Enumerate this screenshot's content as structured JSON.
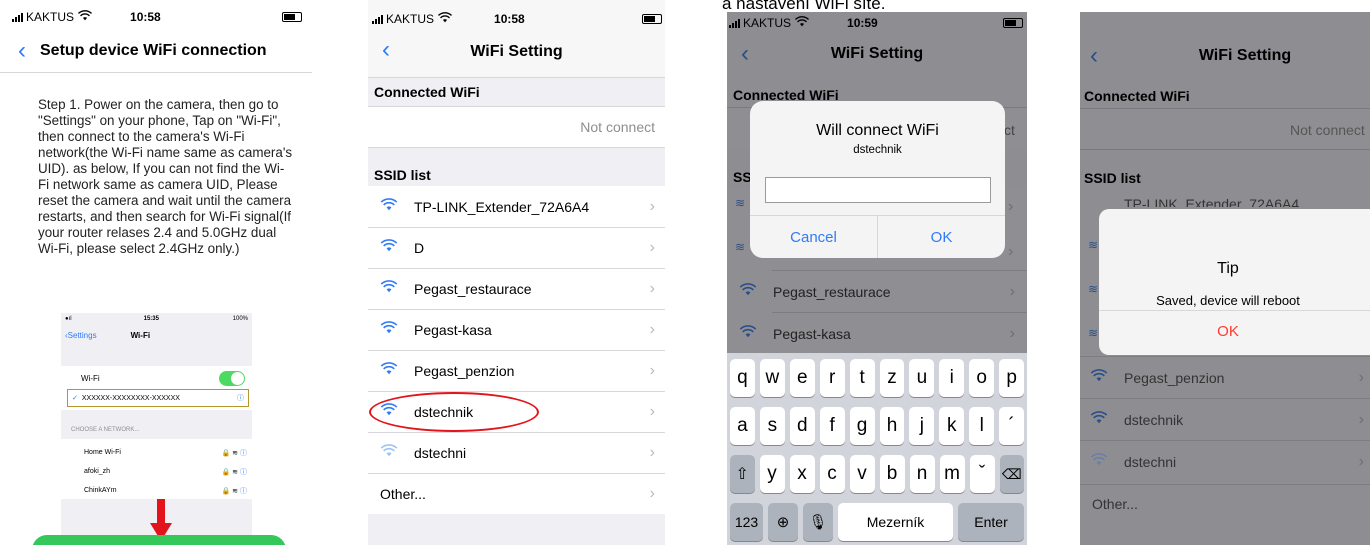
{
  "screen1": {
    "carrier": "KAKTUS",
    "time": "10:58",
    "title": "Setup device WiFi connection",
    "step_text": "Step 1. Power on the camera, then go to \"Settings\" on your phone, Tap on \"Wi-Fi\", then connect to the camera's Wi-Fi network(the Wi-Fi name same as camera's UID). as below, If you can not find the Wi-Fi network same as camera UID, Please reset the camera and wait until the camera restarts, and then search for Wi-Fi signal(If your router relases 2.4 and 5.0GHz dual Wi-Fi, please select 2.4GHz only.)",
    "mini": {
      "time": "15:35",
      "battery": "100%",
      "back_label": "Settings",
      "title": "Wi-Fi",
      "wifi_label": "Wi-Fi",
      "connected_ssid": "XXXXXX-XXXXXXXX-XXXXXX",
      "choose_label": "CHOOSE A NETWORK...",
      "networks": [
        "Home Wi-Fi",
        "afoki_zh",
        "ChinkAYm"
      ]
    }
  },
  "screen2": {
    "carrier": "KAKTUS",
    "time": "10:58",
    "title": "WiFi Setting",
    "connected_header": "Connected WiFi",
    "connected_value": "Not connect",
    "ssid_header": "SSID list",
    "ssids": [
      "TP-LINK_Extender_72A6A4",
      "D",
      "Pegast_restaurace",
      "Pegast-kasa",
      "Pegast_penzion",
      "dstechnik",
      "dstechni"
    ],
    "other": "Other..."
  },
  "screen3": {
    "caption": "a nastavení WiFi sítě.",
    "carrier": "KAKTUS",
    "time": "10:59",
    "title": "WiFi Setting",
    "connected_header": "Connected WiFi",
    "connected_value_partial": "ct",
    "ssid_partial": "SS",
    "dialog": {
      "title": "Will connect WiFi",
      "subtitle": "dstechnik",
      "input_value": "",
      "cancel": "Cancel",
      "ok": "OK"
    },
    "ssids_visible": [
      "Pegast_restaurace",
      "Pegast-kasa"
    ],
    "keyboard": {
      "row1": [
        "q",
        "w",
        "e",
        "r",
        "t",
        "z",
        "u",
        "i",
        "o",
        "p"
      ],
      "row2": [
        "a",
        "s",
        "d",
        "f",
        "g",
        "h",
        "j",
        "k",
        "l",
        "´"
      ],
      "row3": [
        "y",
        "x",
        "c",
        "v",
        "b",
        "n",
        "m",
        "ˇ"
      ],
      "numbers_key": "123",
      "space_key": "Mezerník",
      "enter_key": "Enter"
    }
  },
  "screen4": {
    "title": "WiFi Setting",
    "connected_header": "Connected WiFi",
    "connected_value": "Not connect",
    "ssid_header": "SSID list",
    "ssid_partial": "TP-LINK_Extender_72A6A4",
    "ssids_visible": [
      "Pegast_penzion",
      "dstechnik",
      "dstechni"
    ],
    "other": "Other...",
    "tip": {
      "title": "Tip",
      "message": "Saved, device will reboot",
      "ok": "OK"
    }
  },
  "colors": {
    "ios_blue": "#2f7cf6",
    "green": "#34c759",
    "red": "#e3131b",
    "ok_red": "#ff3b30"
  }
}
